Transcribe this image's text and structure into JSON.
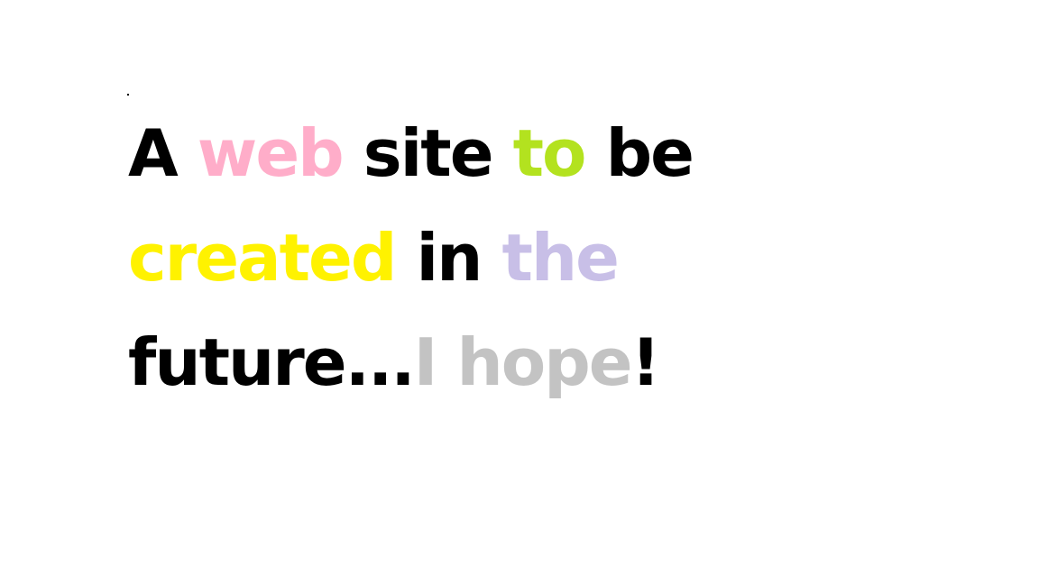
{
  "lines": [
    [
      {
        "text": "A ",
        "color": "#000000"
      },
      {
        "text": "web",
        "color": "#ffadc9"
      },
      {
        "text": " site ",
        "color": "#000000"
      },
      {
        "text": "to",
        "color": "#b3e21f"
      },
      {
        "text": " be",
        "color": "#000000"
      }
    ],
    [
      {
        "text": "created",
        "color": "#fff200"
      },
      {
        "text": " in ",
        "color": "#000000"
      },
      {
        "text": "the",
        "color": "#c8bfe7"
      }
    ],
    [
      {
        "text": "future...",
        "color": "#000000"
      },
      {
        "text": "I hope",
        "color": "#c3c3c3"
      },
      {
        "text": "!",
        "color": "#000000"
      }
    ]
  ]
}
